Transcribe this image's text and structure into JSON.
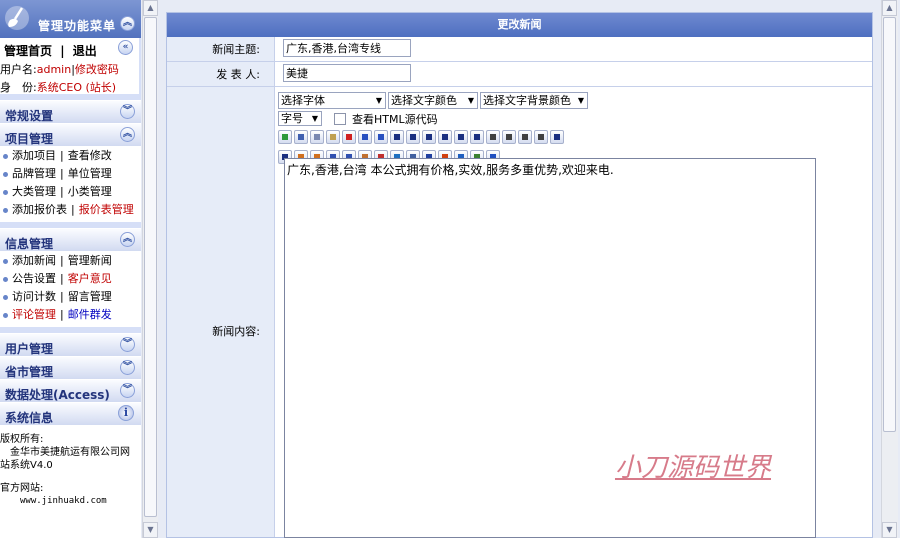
{
  "sidebar": {
    "title": "管理功能菜单",
    "user": {
      "home": "管理首页",
      "sep": "|",
      "logout": "退出",
      "username_label": "用户名:",
      "username": "admin",
      "change_pwd": "修改密码",
      "role_label": "身　份:",
      "role": "系统CEO (站长)"
    },
    "sections": {
      "general": "常规设置",
      "project": "项目管理",
      "info": "信息管理",
      "users": "用户管理",
      "province": "省市管理",
      "data": "数据处理(Access)",
      "sysinfo": "系统信息"
    },
    "project_items": [
      {
        "a": "添加项目",
        "b": "查看修改"
      },
      {
        "a": "品牌管理",
        "b": "单位管理"
      },
      {
        "a": "大类管理",
        "b": "小类管理"
      },
      {
        "a": "添加报价表",
        "b": "报价表管理"
      }
    ],
    "info_items": [
      {
        "a": "添加新闻",
        "b": "管理新闻"
      },
      {
        "a": "公告设置",
        "b": "客户意见"
      },
      {
        "a": "访问计数",
        "b": "留言管理"
      },
      {
        "a": "评论管理",
        "b": "邮件群发"
      }
    ],
    "copyright_label": "版权所有:",
    "copyright_line1": "金华市美捷航运有限公司网",
    "copyright_line2": "站系统V4.0",
    "site_label": "官方网站:",
    "site_url": "www.jinhuakd.com"
  },
  "form": {
    "header": "更改新闻",
    "subject_label": "新闻主题:",
    "subject_value": "广东,香港,台湾专线",
    "author_label": "发 表 人:",
    "author_value": "美捷",
    "content_label": "新闻内容:",
    "font_select": "选择字体",
    "color_select": "选择文字颜色",
    "bgcolor_select": "选择文字背景颜色",
    "size_select": "字号",
    "html_source": "查看HTML源代码",
    "content_text": "广东,香港,台湾  本公式拥有价格,实效,服务多重优势,欢迎来电.",
    "watermark": "小刀源码世界"
  }
}
